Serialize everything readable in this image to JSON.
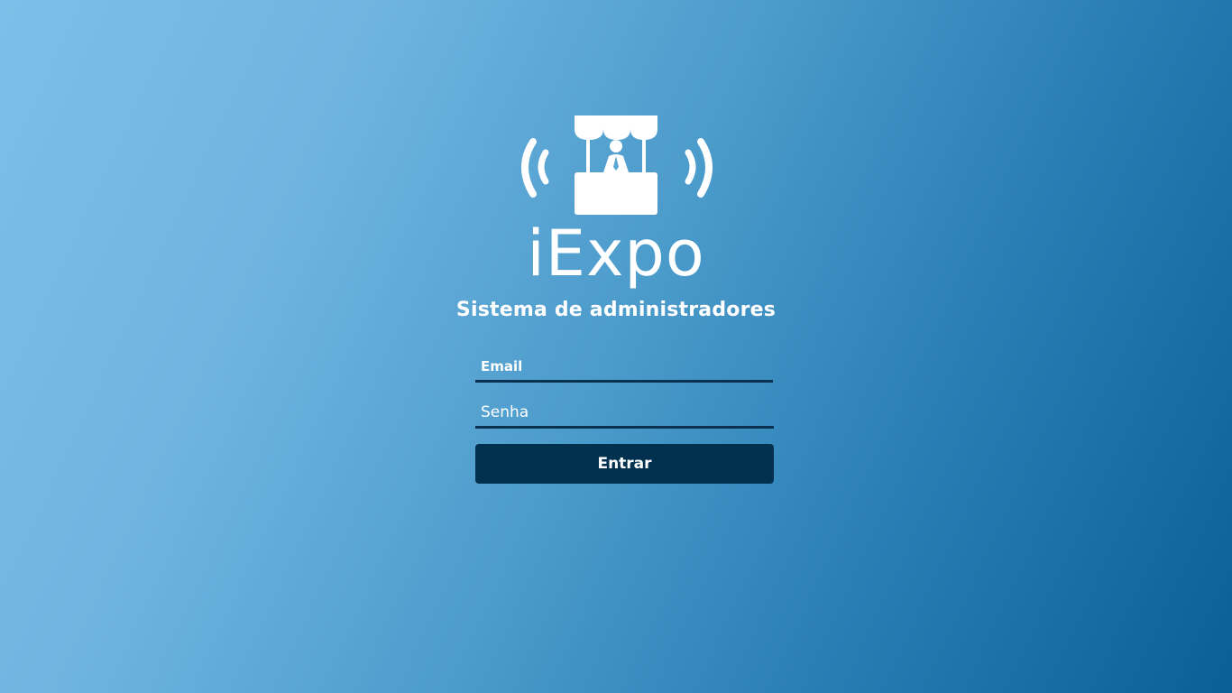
{
  "logo": {
    "icon": "expo-booth-broadcast-icon",
    "color": "#ffffff"
  },
  "brand": {
    "name": "iExpo"
  },
  "subtitle": "Sistema de administradores",
  "form": {
    "email_placeholder": "Email",
    "email_value": "",
    "password_placeholder": "Senha",
    "password_value": "",
    "submit_label": "Entrar"
  },
  "colors": {
    "background_start": "#7cc0e9",
    "background_end": "#0a5f97",
    "input_underline": "#0b3150",
    "button_bg": "#02304f",
    "text": "#ffffff"
  }
}
